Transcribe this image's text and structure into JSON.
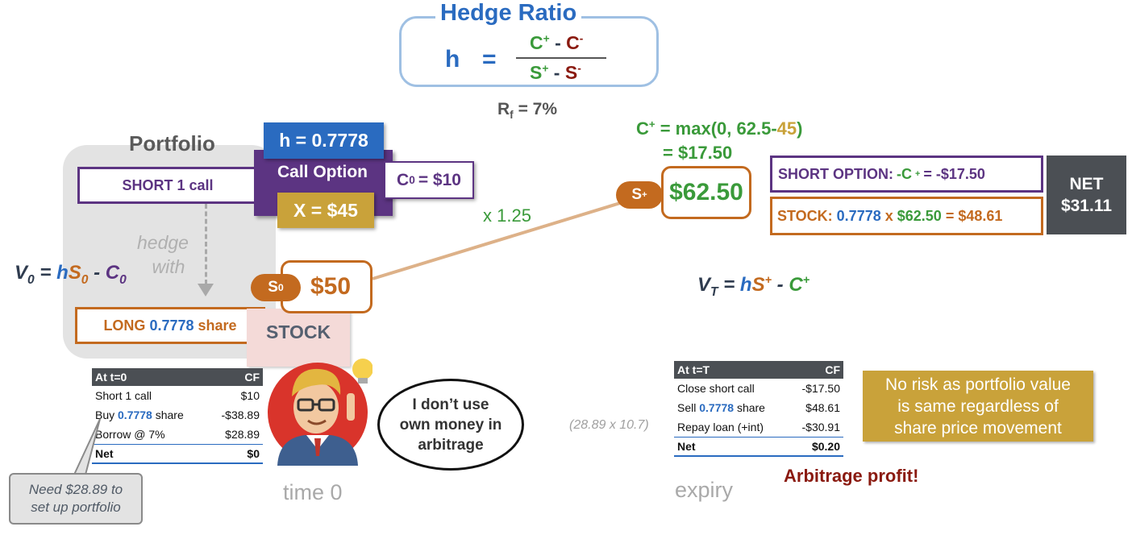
{
  "hedge_ratio": {
    "title": "Hedge Ratio",
    "h": "h",
    "eq": "=",
    "c_plus": "C",
    "c_minus": "C",
    "s_plus": "S",
    "s_minus": "S",
    "sup_plus": "+",
    "sup_minus": "-",
    "minus": "-"
  },
  "rf": {
    "label": "R",
    "sub": "f",
    "value": "= 7%"
  },
  "portfolio": {
    "title": "Portfolio",
    "short_call": "SHORT 1 call",
    "hedge_with_1": "hedge",
    "hedge_with_2": "with",
    "long_prefix": "LONG",
    "long_qty": "0.7778",
    "long_suffix": "share",
    "v0_v": "V",
    "v0_sub": "0",
    "v0_eq": "=",
    "v0_h": "h",
    "v0_s": "S",
    "v0_s_sub": "0",
    "v0_minus": "-",
    "v0_c": "C",
    "v0_c_sub": "0"
  },
  "call_option": {
    "h_badge": "h = 0.7778",
    "label": "Call Option",
    "c0_c": "C",
    "c0_sub": "0",
    "c0_val": "= $10",
    "strike": "X = $45"
  },
  "stock": {
    "label": "STOCK",
    "s0_tag_s": "S",
    "s0_tag_sub": "0",
    "s0_price": "$50",
    "growth": "x 1.25",
    "splus_tag_s": "S",
    "splus_tag_sup": "+",
    "splus_price": "$62.50"
  },
  "payoff": {
    "cplus_c": "C",
    "cplus_sup": "+",
    "cplus_mid": "= max(0, 62.5-",
    "cplus_strike": "45",
    "cplus_close": ")",
    "cplus_line2": "= $17.50",
    "short_option_prefix": "SHORT OPTION:",
    "short_option_formula_c": "-C",
    "short_option_formula_sup": "+",
    "short_option_value": "= -$17.50",
    "stock_prefix": "STOCK:",
    "stock_qty": "0.7778",
    "stock_x": "x",
    "stock_price": "$62.50",
    "stock_value": "= $48.61",
    "net_label": "NET",
    "net_value": "$31.11",
    "vt_v": "V",
    "vt_sub": "T",
    "vt_eq": "=",
    "vt_h": "h",
    "vt_s": "S",
    "vt_s_sup": "+",
    "vt_minus": "-",
    "vt_c": "C",
    "vt_c_sup": "+"
  },
  "table_t0": {
    "header_left": "At t=0",
    "header_right": "CF",
    "rows": [
      {
        "label_a": "Short 1 call",
        "label_b": "",
        "label_c": "",
        "value": "$10"
      },
      {
        "label_a": "Buy ",
        "label_b": "0.7778",
        "label_c": " share",
        "value": "-$38.89"
      },
      {
        "label_a": "Borrow @ 7%",
        "label_b": "",
        "label_c": "",
        "value": "$28.89"
      }
    ],
    "net_label": "Net",
    "net_value": "$0"
  },
  "table_tT": {
    "header_left": "At t=T",
    "header_right": "CF",
    "rows": [
      {
        "label_a": "Close short call",
        "label_b": "",
        "label_c": "",
        "value": "-$17.50"
      },
      {
        "label_a": "Sell ",
        "label_b": "0.7778",
        "label_c": " share",
        "value": "$48.61"
      },
      {
        "label_a": "Repay loan (+int)",
        "label_b": "",
        "label_c": "",
        "value": "-$30.91"
      }
    ],
    "net_label": "Net",
    "net_value": "$0.20"
  },
  "callout_need": {
    "line1": "Need $28.89 to",
    "line2": "set up portfolio"
  },
  "speech": {
    "line1": "I don’t use",
    "line2": "own money in",
    "line3": "arbitrage"
  },
  "labels": {
    "time0": "time 0",
    "expiry": "expiry",
    "loan_calc": "(28.89 x 10.7)",
    "no_risk_1": "No risk as portfolio value",
    "no_risk_2": "is same regardless of",
    "no_risk_3": "share price movement",
    "arb_profit": "Arbitrage profit!"
  },
  "colors": {
    "blue": "#2a6bc0",
    "green": "#3a9a3a",
    "dark_red": "#8a1a10",
    "orange": "#c36a1f",
    "purple": "#5c3482",
    "gold": "#c9a23a",
    "net_gray": "#4b4f54"
  }
}
